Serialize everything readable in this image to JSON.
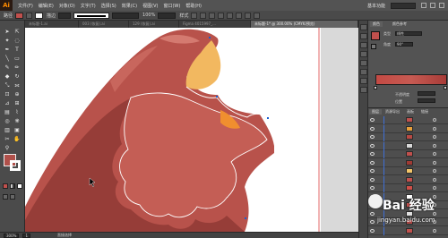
{
  "menubar": {
    "logo": "Ai",
    "items": [
      "文件(F)",
      "编辑(E)",
      "对象(O)",
      "文字(T)",
      "选择(S)",
      "效果(C)",
      "视图(V)",
      "窗口(W)",
      "帮助(H)"
    ],
    "workspace": "基本功能"
  },
  "controlbar": {
    "label": "路径",
    "fill_color": "#c0504d",
    "stroke_label": "描边",
    "opacity_value": "100%",
    "style_label": "样式"
  },
  "tabs": [
    {
      "label": "未标题-1.ai",
      "active": false
    },
    {
      "label": "003 (恢复).ai",
      "active": false
    },
    {
      "label": "129 (恢复).ai",
      "active": false
    },
    {
      "label": "Figma 4015997_...",
      "active": false
    },
    {
      "label": "未标题-1* @ 300.00% (CMYK/预览)",
      "active": true
    }
  ],
  "tools": {
    "icons": [
      "selection-tool",
      "direct-selection-tool",
      "magic-wand-tool",
      "lasso-tool",
      "pen-tool",
      "type-tool",
      "line-tool",
      "rectangle-tool",
      "paintbrush-tool",
      "pencil-tool",
      "eraser-tool",
      "rotate-tool",
      "scale-tool",
      "width-tool",
      "free-transform-tool",
      "shape-builder-tool",
      "perspective-tool",
      "mesh-tool",
      "gradient-tool",
      "eyedropper-tool",
      "blend-tool",
      "symbol-sprayer-tool",
      "column-graph-tool",
      "artboard-tool",
      "slice-tool",
      "hand-tool",
      "zoom-tool"
    ],
    "fill_color": "#b0504a",
    "stroke_color": "#ffffff"
  },
  "status": {
    "zoom": "300%",
    "page": "1",
    "mode": "直接选择"
  },
  "color_panel": {
    "tabs": [
      "颜色",
      "颜色参考"
    ],
    "type_label": "类型",
    "type_value": "线性",
    "angle_label": "角度",
    "angle_value": "90°",
    "opacity_label": "不透明度",
    "location_label": "位置",
    "gradient_start": "#c44a44",
    "gradient_end": "#a83c38"
  },
  "layers_panel": {
    "tabs": [
      "图层",
      "资源导出",
      "画板",
      "链接"
    ],
    "rows": 14,
    "thumb_colors": [
      "#c0504d",
      "#e8a03a",
      "#b94a44",
      "#d9d9d9",
      "#c0504d",
      "#a03a34",
      "#f3c66a",
      "#c0504d",
      "#d04f48",
      "#ffffff",
      "#c0504d",
      "#e0e0e0",
      "#c0504d",
      "#c0504d"
    ]
  },
  "watermark": {
    "brand": "Bai 经验",
    "url": "jingyan.baidu.com"
  },
  "artwork": {
    "main_color": "#b8524b",
    "shadow_color": "#8f3a35",
    "highlight_color": "#d37369",
    "bite_color": "#f2b860",
    "background": "#ffffff"
  }
}
